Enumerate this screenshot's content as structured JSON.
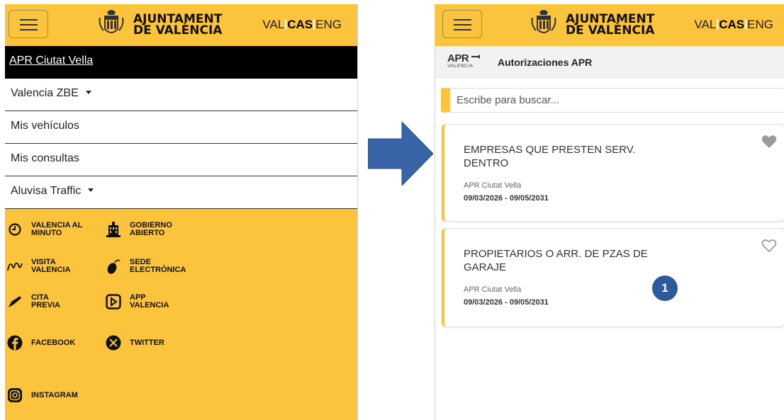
{
  "header": {
    "brand_line1": "AJUNTAMENT",
    "brand_line2": "DE VALÈNCIA",
    "lang_val": "VAL",
    "lang_cas": "CAS",
    "lang_eng": "ENG",
    "active_lang": "CAS"
  },
  "menu": {
    "active": "APR Ciutat Vella",
    "items": [
      {
        "label": "Valencia ZBE",
        "has_caret": true
      },
      {
        "label": "Mis vehículos",
        "has_caret": false
      },
      {
        "label": "Mis consultas",
        "has_caret": false
      },
      {
        "label": "Aluvisa Traffic",
        "has_caret": true
      }
    ]
  },
  "links": [
    {
      "label": "VALENCIA AL\nMINUTO",
      "icon": "clock-icon"
    },
    {
      "label": "GOBIERNO\nABIERTO",
      "icon": "building-icon"
    },
    {
      "label": "VISITA\nVALENCIA",
      "icon": "map-icon"
    },
    {
      "label": "SEDE\nELECTRÓNICA",
      "icon": "mouse-icon"
    },
    {
      "label": "CITA\nPREVIA",
      "icon": "pen-icon"
    },
    {
      "label": "APP\nVALENCIA",
      "icon": "app-icon"
    },
    {
      "label": "FACEBOOK",
      "icon": "facebook-icon"
    },
    {
      "label": "TWITTER",
      "icon": "x-twitter-icon"
    },
    {
      "label": "INSTAGRAM",
      "icon": "instagram-icon"
    }
  ],
  "apr": {
    "logo_text": "APR",
    "logo_sub": "VALENCIA",
    "title": "Autorizaciones APR",
    "search_placeholder": "Escribe para buscar..."
  },
  "cards": [
    {
      "title": "EMPRESAS QUE PRESTEN SERV. DENTRO",
      "zone": "APR Ciutat Vella",
      "dates": "09/03/2026 - 09/05/2031",
      "favorite": true
    },
    {
      "title": "PROPIETARIOS O ARR. DE PZAS DE GARAJE",
      "zone": "APR Ciutat Vella",
      "dates": "09/03/2026 - 09/05/2031",
      "favorite": false
    }
  ],
  "annotation": {
    "badge": "1"
  },
  "colors": {
    "brand_yellow": "#fcc33c",
    "arrow_blue": "#3a64a8",
    "badge_blue": "#2e5a9c"
  }
}
